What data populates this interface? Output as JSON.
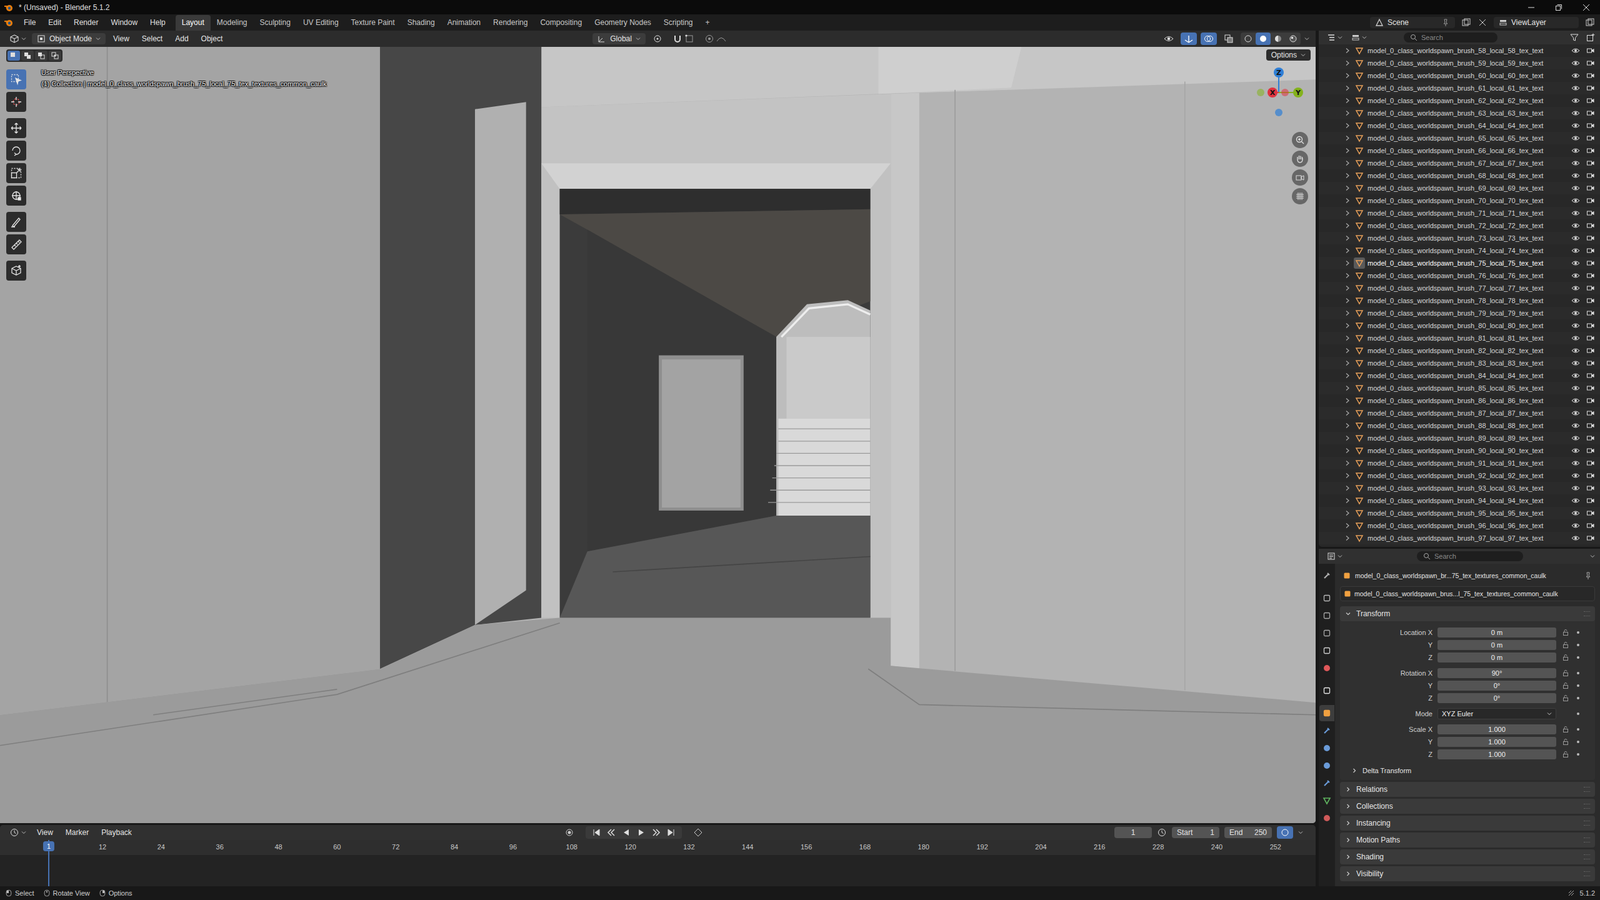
{
  "window": {
    "title": "* (Unsaved) - Blender 5.1.2"
  },
  "menu": [
    "File",
    "Edit",
    "Render",
    "Window",
    "Help"
  ],
  "workspaces": [
    {
      "label": "Layout",
      "selected": true
    },
    {
      "label": "Modeling",
      "selected": false
    },
    {
      "label": "Sculpting",
      "selected": false
    },
    {
      "label": "UV Editing",
      "selected": false
    },
    {
      "label": "Texture Paint",
      "selected": false
    },
    {
      "label": "Shading",
      "selected": false
    },
    {
      "label": "Animation",
      "selected": false
    },
    {
      "label": "Rendering",
      "selected": false
    },
    {
      "label": "Compositing",
      "selected": false
    },
    {
      "label": "Geometry Nodes",
      "selected": false
    },
    {
      "label": "Scripting",
      "selected": false
    }
  ],
  "add_workspace": "+",
  "scene": "Scene",
  "view_layer": "ViewLayer",
  "viewport": {
    "mode": "Object Mode",
    "menus": [
      "View",
      "Select",
      "Add",
      "Object"
    ],
    "orientation": "Global",
    "options": "Options",
    "view_name": "User Perspective",
    "context": "(1) Collection | model_0_class_worldspawn_brush_75_local_75_tex_textures_common_caulk",
    "select_modes": [
      {
        "kind": "new",
        "selected": true
      },
      {
        "kind": "extend",
        "selected": false
      },
      {
        "kind": "subtract",
        "selected": false
      },
      {
        "kind": "intersect",
        "selected": false
      }
    ],
    "tools": [
      {
        "kind": "select",
        "selected": true
      },
      {
        "kind": "cursor",
        "selected": false
      },
      {
        "kind": "move",
        "selected": false
      },
      {
        "kind": "rotate",
        "selected": false
      },
      {
        "kind": "scale",
        "selected": false
      },
      {
        "kind": "transform",
        "selected": false
      },
      {
        "kind": "annotate",
        "selected": false
      },
      {
        "kind": "measure",
        "selected": false
      },
      {
        "kind": "add-cube",
        "selected": false
      }
    ],
    "toggles": [
      {
        "kind": "visibility",
        "selected": false
      },
      {
        "kind": "gizmos",
        "selected": true
      },
      {
        "kind": "overlays",
        "selected": true
      },
      {
        "kind": "xray",
        "selected": false
      }
    ],
    "shading": [
      {
        "kind": "wireframe",
        "selected": false
      },
      {
        "kind": "solid",
        "selected": true
      },
      {
        "kind": "material",
        "selected": false
      },
      {
        "kind": "rendered",
        "selected": false
      }
    ],
    "gizmo": [
      {
        "label": "Z",
        "color": "#2f7fd6"
      },
      {
        "label": "X",
        "color": "#e0323f"
      },
      {
        "label": "Y",
        "color": "#84b21c"
      }
    ]
  },
  "outliner": {
    "search": "Search",
    "rows": [
      {
        "name": "model_0_class_worldspawn_brush_58_local_58_tex_text",
        "visible": true,
        "selected": false
      },
      {
        "name": "model_0_class_worldspawn_brush_59_local_59_tex_text",
        "visible": true,
        "selected": false
      },
      {
        "name": "model_0_class_worldspawn_brush_60_local_60_tex_text",
        "visible": true,
        "selected": false
      },
      {
        "name": "model_0_class_worldspawn_brush_61_local_61_tex_text",
        "visible": true,
        "selected": false
      },
      {
        "name": "model_0_class_worldspawn_brush_62_local_62_tex_text",
        "visible": true,
        "selected": false
      },
      {
        "name": "model_0_class_worldspawn_brush_63_local_63_tex_text",
        "visible": true,
        "selected": false
      },
      {
        "name": "model_0_class_worldspawn_brush_64_local_64_tex_text",
        "visible": true,
        "selected": false
      },
      {
        "name": "model_0_class_worldspawn_brush_65_local_65_tex_text",
        "visible": true,
        "selected": false
      },
      {
        "name": "model_0_class_worldspawn_brush_66_local_66_tex_text",
        "visible": true,
        "selected": false
      },
      {
        "name": "model_0_class_worldspawn_brush_67_local_67_tex_text",
        "visible": true,
        "selected": false
      },
      {
        "name": "model_0_class_worldspawn_brush_68_local_68_tex_text",
        "visible": true,
        "selected": false
      },
      {
        "name": "model_0_class_worldspawn_brush_69_local_69_tex_text",
        "visible": true,
        "selected": false
      },
      {
        "name": "model_0_class_worldspawn_brush_70_local_70_tex_text",
        "visible": true,
        "selected": false
      },
      {
        "name": "model_0_class_worldspawn_brush_71_local_71_tex_text",
        "visible": true,
        "selected": false
      },
      {
        "name": "model_0_class_worldspawn_brush_72_local_72_tex_text",
        "visible": true,
        "selected": false
      },
      {
        "name": "model_0_class_worldspawn_brush_73_local_73_tex_text",
        "visible": true,
        "selected": false
      },
      {
        "name": "model_0_class_worldspawn_brush_74_local_74_tex_text",
        "visible": true,
        "selected": false
      },
      {
        "name": "model_0_class_worldspawn_brush_75_local_75_tex_text",
        "visible": true,
        "selected": true
      },
      {
        "name": "model_0_class_worldspawn_brush_76_local_76_tex_text",
        "visible": true,
        "selected": false
      },
      {
        "name": "model_0_class_worldspawn_brush_77_local_77_tex_text",
        "visible": true,
        "selected": false
      },
      {
        "name": "model_0_class_worldspawn_brush_78_local_78_tex_text",
        "visible": true,
        "selected": false
      },
      {
        "name": "model_0_class_worldspawn_brush_79_local_79_tex_text",
        "visible": true,
        "selected": false
      },
      {
        "name": "model_0_class_worldspawn_brush_80_local_80_tex_text",
        "visible": true,
        "selected": false
      },
      {
        "name": "model_0_class_worldspawn_brush_81_local_81_tex_text",
        "visible": true,
        "selected": false
      },
      {
        "name": "model_0_class_worldspawn_brush_82_local_82_tex_text",
        "visible": true,
        "selected": false
      },
      {
        "name": "model_0_class_worldspawn_brush_83_local_83_tex_text",
        "visible": true,
        "selected": false
      },
      {
        "name": "model_0_class_worldspawn_brush_84_local_84_tex_text",
        "visible": true,
        "selected": false
      },
      {
        "name": "model_0_class_worldspawn_brush_85_local_85_tex_text",
        "visible": true,
        "selected": false
      },
      {
        "name": "model_0_class_worldspawn_brush_86_local_86_tex_text",
        "visible": true,
        "selected": false
      },
      {
        "name": "model_0_class_worldspawn_brush_87_local_87_tex_text",
        "visible": true,
        "selected": false
      },
      {
        "name": "model_0_class_worldspawn_brush_88_local_88_tex_text",
        "visible": true,
        "selected": false
      },
      {
        "name": "model_0_class_worldspawn_brush_89_local_89_tex_text",
        "visible": true,
        "selected": false
      },
      {
        "name": "model_0_class_worldspawn_brush_90_local_90_tex_text",
        "visible": true,
        "selected": false
      },
      {
        "name": "model_0_class_worldspawn_brush_91_local_91_tex_text",
        "visible": true,
        "selected": false
      },
      {
        "name": "model_0_class_worldspawn_brush_92_local_92_tex_text",
        "visible": true,
        "selected": false
      },
      {
        "name": "model_0_class_worldspawn_brush_93_local_93_tex_text",
        "visible": true,
        "selected": false
      },
      {
        "name": "model_0_class_worldspawn_brush_94_local_94_tex_text",
        "visible": true,
        "selected": false
      },
      {
        "name": "model_0_class_worldspawn_brush_95_local_95_tex_text",
        "visible": true,
        "selected": false
      },
      {
        "name": "model_0_class_worldspawn_brush_96_local_96_tex_text",
        "visible": true,
        "selected": false
      },
      {
        "name": "model_0_class_worldspawn_brush_97_local_97_tex_text",
        "visible": true,
        "selected": false
      }
    ]
  },
  "properties": {
    "search": "Search",
    "tabs": [
      {
        "kind": "tool",
        "selected": false
      },
      {
        "kind": "render",
        "selected": false
      },
      {
        "kind": "output",
        "selected": false
      },
      {
        "kind": "view-layer",
        "selected": false
      },
      {
        "kind": "scene",
        "selected": false
      },
      {
        "kind": "world",
        "selected": false
      },
      {
        "kind": "collection",
        "selected": false
      },
      {
        "kind": "object",
        "selected": true
      },
      {
        "kind": "modifiers",
        "selected": false
      },
      {
        "kind": "particles",
        "selected": false
      },
      {
        "kind": "physics",
        "selected": false
      },
      {
        "kind": "constraints",
        "selected": false
      },
      {
        "kind": "data",
        "selected": false
      },
      {
        "kind": "material",
        "selected": false
      }
    ],
    "object_name": "model_0_class_worldspawn_br...75_tex_textures_common_caulk",
    "data_name": "model_0_class_worldspawn_brus...l_75_tex_textures_common_caulk",
    "transform": {
      "title": "Transform",
      "expanded": true,
      "groups": [
        {
          "rows": [
            {
              "label": "Location X",
              "value": "0 m",
              "kind": "field"
            },
            {
              "label": "Y",
              "value": "0 m",
              "kind": "field"
            },
            {
              "label": "Z",
              "value": "0 m",
              "kind": "field"
            }
          ]
        },
        {
          "rows": [
            {
              "label": "Rotation X",
              "value": "90°",
              "kind": "field"
            },
            {
              "label": "Y",
              "value": "0°",
              "kind": "field"
            },
            {
              "label": "Z",
              "value": "0°",
              "kind": "field"
            }
          ]
        },
        {
          "rows": [
            {
              "label": "Mode",
              "value": "XYZ Euler",
              "kind": "dropdown"
            }
          ]
        },
        {
          "rows": [
            {
              "label": "Scale X",
              "value": "1.000",
              "kind": "field"
            },
            {
              "label": "Y",
              "value": "1.000",
              "kind": "field"
            },
            {
              "label": "Z",
              "value": "1.000",
              "kind": "field"
            }
          ]
        }
      ],
      "subpanels": [
        {
          "label": "Delta Transform",
          "expanded": false
        }
      ]
    },
    "panels": [
      {
        "label": "Relations",
        "expanded": false
      },
      {
        "label": "Collections",
        "expanded": false
      },
      {
        "label": "Instancing",
        "expanded": false
      },
      {
        "label": "Motion Paths",
        "expanded": false
      },
      {
        "label": "Shading",
        "expanded": false
      },
      {
        "label": "Visibility",
        "expanded": false
      }
    ]
  },
  "timeline": {
    "menus": [
      "View",
      "Marker",
      "Playback"
    ],
    "current_frame": "1",
    "start_label": "Start",
    "start": "1",
    "end_label": "End",
    "end": "250",
    "ticks": [
      "12",
      "24",
      "36",
      "48",
      "60",
      "72",
      "84",
      "96",
      "108",
      "120",
      "132",
      "144",
      "156",
      "168",
      "180",
      "192",
      "204",
      "216",
      "228",
      "240",
      "252"
    ]
  },
  "status_bar": {
    "hints": [
      "Select",
      "Rotate View",
      "Options"
    ],
    "version": "5.1.2"
  }
}
